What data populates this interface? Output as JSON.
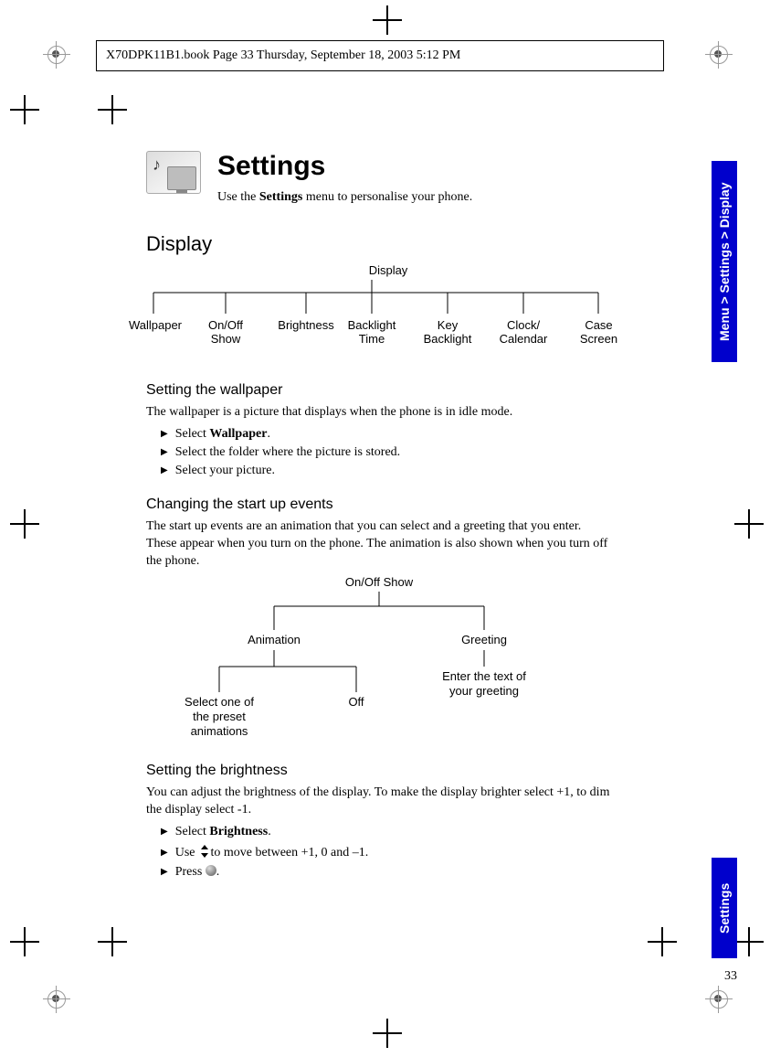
{
  "header": {
    "book_info": "X70DPK11B1.book  Page 33  Thursday, September 18, 2003  5:12 PM"
  },
  "title": {
    "heading": "Settings",
    "intro_prefix": "Use the ",
    "intro_bold": "Settings",
    "intro_suffix": " menu to personalise your phone."
  },
  "display": {
    "heading": "Display",
    "tree": {
      "root": "Display",
      "leaves": [
        "Wallpaper",
        "On/Off\nShow",
        "Brightness",
        "Backlight\nTime",
        "Key\nBacklight",
        "Clock/\nCalendar",
        "Case\nScreen"
      ]
    }
  },
  "wallpaper": {
    "heading": "Setting the wallpaper",
    "desc": "The wallpaper is a picture that displays when the phone is in idle mode.",
    "step1_prefix": "Select ",
    "step1_bold": "Wallpaper",
    "step1_suffix": ".",
    "step2": "Select the folder where the picture is stored.",
    "step3": "Select your picture."
  },
  "startup": {
    "heading": "Changing the start up events",
    "desc": "The start up events are an animation that you can select and a greeting that you enter. These appear when you turn on the phone. The animation is also shown when you turn off the phone.",
    "tree": {
      "root": "On/Off Show",
      "animation": "Animation",
      "greeting": "Greeting",
      "greeting_leaf": "Enter the text of\nyour greeting",
      "anim_leaf1": "Select one of\nthe preset\nanimations",
      "anim_leaf2": "Off"
    }
  },
  "brightness": {
    "heading": "Setting the brightness",
    "desc": "You can adjust the brightness of the display. To make the display brighter select +1, to dim the display select -1.",
    "step1_prefix": "Select ",
    "step1_bold": "Brightness",
    "step1_suffix": ".",
    "step2_prefix": "Use ",
    "step2_suffix": " to move between +1, 0 and –1.",
    "step3_prefix": "Press ",
    "step3_suffix": "."
  },
  "sidebar": {
    "breadcrumb": "Menu > Settings > Display",
    "section": "Settings"
  },
  "page_number": "33"
}
